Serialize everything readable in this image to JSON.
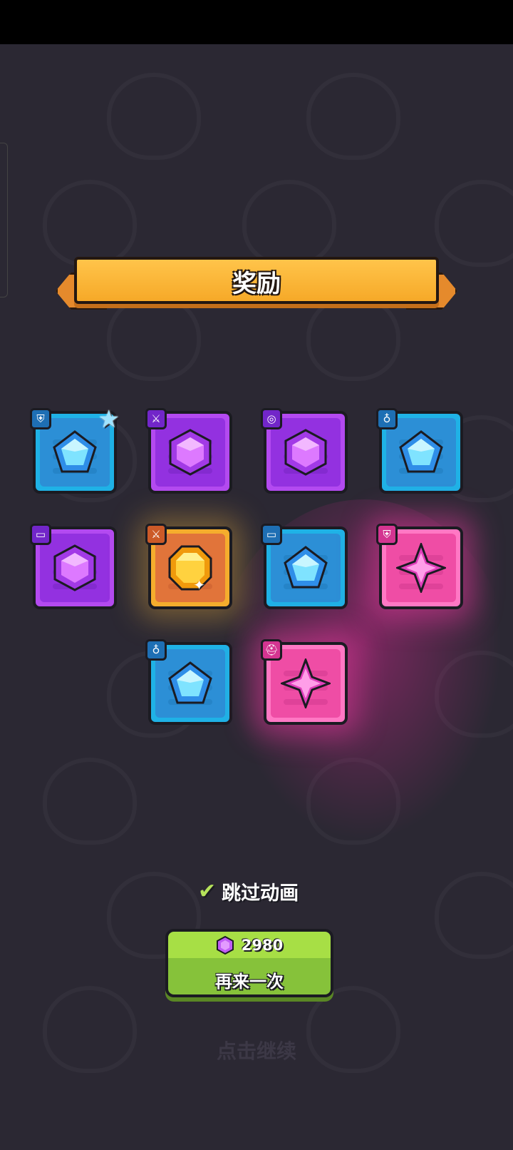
{
  "banner": {
    "title": "奖励"
  },
  "rewards": [
    {
      "slot": "armor-icon",
      "tag_glyph": "⛨",
      "gem": "blue-pentagon",
      "rarity_color": "#1fb2e6",
      "star": true
    },
    {
      "slot": "sword-icon",
      "tag_glyph": "⚔",
      "gem": "purple-hexagon",
      "rarity_color": "#b34af0"
    },
    {
      "slot": "ring-icon",
      "tag_glyph": "◎",
      "gem": "purple-hexagon",
      "rarity_color": "#b34af0"
    },
    {
      "slot": "necklace-icon",
      "tag_glyph": "♁",
      "gem": "blue-pentagon",
      "rarity_color": "#1fb2e6"
    },
    {
      "slot": "belt-icon",
      "tag_glyph": "▭",
      "gem": "purple-hexagon",
      "rarity_color": "#b34af0"
    },
    {
      "slot": "sword-icon",
      "tag_glyph": "⚔",
      "gem": "gold-octagon",
      "rarity_color": "#f5ad2d"
    },
    {
      "slot": "belt-icon",
      "tag_glyph": "▭",
      "gem": "blue-pentagon",
      "rarity_color": "#1fb2e6"
    },
    {
      "slot": "armor-icon",
      "tag_glyph": "⛨",
      "gem": "pink-star",
      "rarity_color": "#ff78c4"
    },
    {
      "slot": "necklace-icon",
      "tag_glyph": "♁",
      "gem": "blue-pentagon",
      "rarity_color": "#1fb2e6"
    },
    {
      "slot": "helmet-icon",
      "tag_glyph": "⛑",
      "gem": "pink-star",
      "rarity_color": "#ff78c4"
    }
  ],
  "skip_animation": {
    "label": "跳过动画",
    "checked": true
  },
  "retry_button": {
    "cost": "2980",
    "cost_icon": "purple-gem-icon",
    "label": "再来一次"
  },
  "continue_hint": "点击继续"
}
